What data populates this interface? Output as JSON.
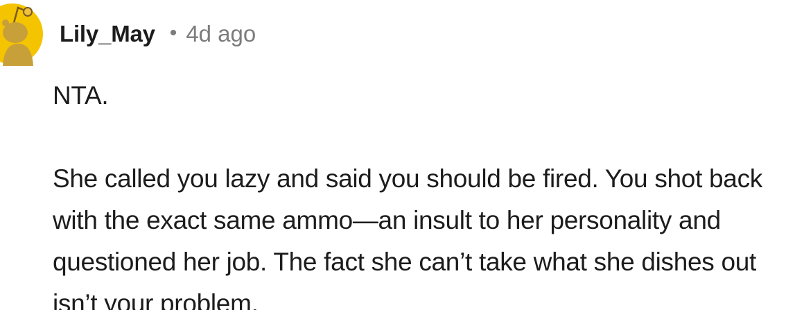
{
  "comment": {
    "avatar_icon": "snoo-avatar-icon",
    "avatar_color": "#f5c400",
    "username": "Lily_May",
    "separator": "•",
    "timestamp": "4d ago",
    "paragraphs": [
      "NTA.",
      "She called you lazy and said you should be fired. You shot back with the exact same ammo—an insult to her personality and questioned her job. The fact she can’t take what she dishes out isn’t your problem."
    ]
  }
}
